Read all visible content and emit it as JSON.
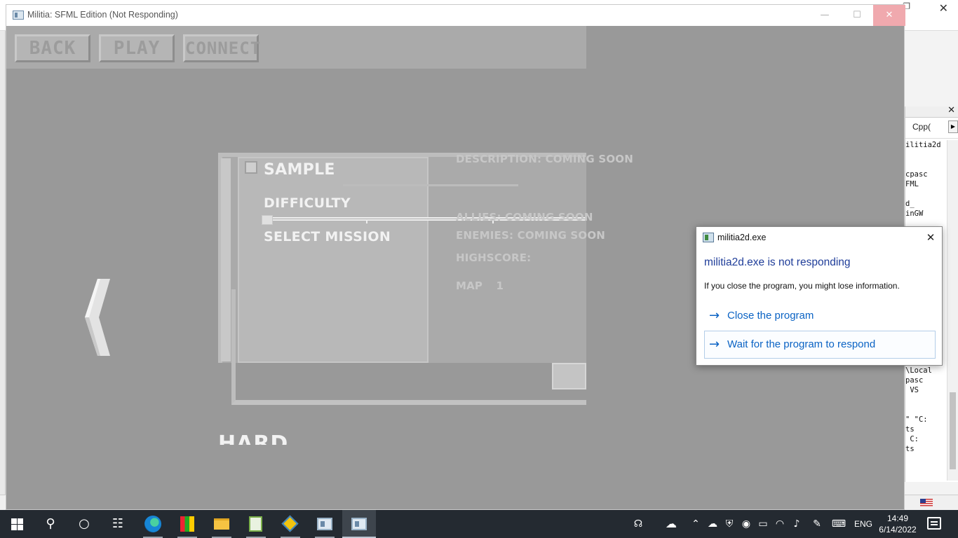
{
  "app_window": {
    "title": "Militia: SFML Edition (Not Responding)",
    "minimize_glyph": "—",
    "maximize_glyph": "☐",
    "close_glyph": "✕"
  },
  "game": {
    "buttons": {
      "back": "BACK",
      "play": "PLAY",
      "connect": "CONNECT"
    },
    "mission_panel": {
      "sample_label": "SAMPLE",
      "difficulty_label": "DIFFICULTY",
      "select_mission_label": "SELECT MISSION",
      "description": "DESCRIPTION: COMING SOON",
      "allies": "ALLIES: COMING SOON",
      "enemies": "ENEMIES: COMING SOON",
      "highscore": "HIGHSCORE:",
      "map": "MAP 1"
    },
    "province_title": "HARD PROVINCE"
  },
  "dialog": {
    "title": "militia2d.exe",
    "heading": "militia2d.exe is not responding",
    "message": "If you close the program, you might lose information.",
    "option_close": "Close the program",
    "option_wait": "Wait for the program to respond",
    "arrow_glyph": "→",
    "close_glyph": "✕"
  },
  "background_ide": {
    "tab_label": "Cpp(",
    "code_lines": [
      "ilitia2d",
      "",
      "",
      "cpasc",
      "FML",
      "",
      "d_",
      "inGW",
      "",
      "",
      "",
      "",
      "",
      "",
      "",
      "",
      "",
      "",
      "",
      "",
      "",
      "",
      "",
      "\\Local",
      "pasc",
      " VS",
      "",
      "",
      "\" \"C:",
      "ts",
      " C:",
      "ts"
    ]
  },
  "taskbar": {
    "language": "ENG",
    "time": "14:49",
    "date": "6/14/2022"
  },
  "colors": {
    "game_background": "#999999",
    "dialog_link": "#0b63c4",
    "dialog_heading": "#1f3d99",
    "taskbar": "#242a31"
  }
}
